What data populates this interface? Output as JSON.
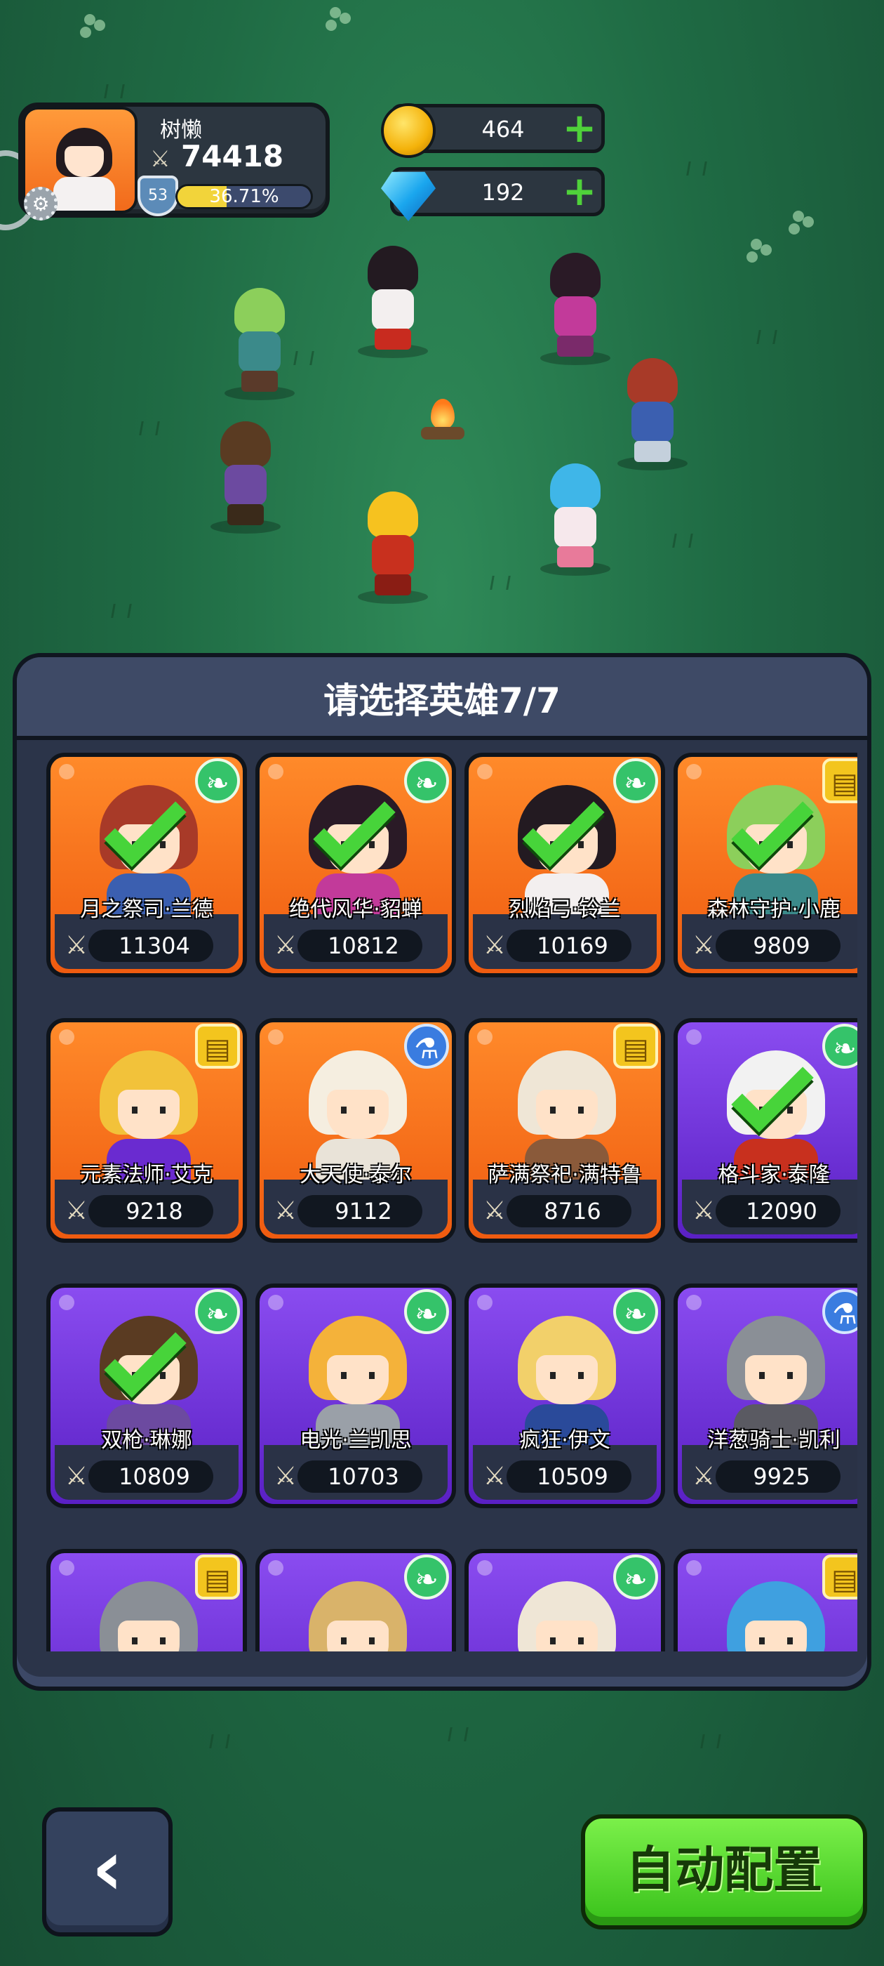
{
  "player": {
    "name": "树懒",
    "power": "74418",
    "level": "53",
    "xp_percent_text": "36.71%",
    "xp_fraction": 0.3671
  },
  "currency": {
    "gold": "464",
    "gems": "192"
  },
  "panel": {
    "title": "请选择英雄7/7"
  },
  "heroes": [
    {
      "name": "月之祭司·兰德",
      "power": "11304",
      "rarity": "orange",
      "badge": "green",
      "selected": true
    },
    {
      "name": "绝代风华·貂蝉",
      "power": "10812",
      "rarity": "orange",
      "badge": "green",
      "selected": true
    },
    {
      "name": "烈焰弓·铃兰",
      "power": "10169",
      "rarity": "orange",
      "badge": "green",
      "selected": true
    },
    {
      "name": "森林守护·小鹿",
      "power": "9809",
      "rarity": "orange",
      "badge": "book",
      "selected": true
    },
    {
      "name": "元素法师·艾克",
      "power": "9218",
      "rarity": "orange",
      "badge": "book",
      "selected": false
    },
    {
      "name": "大天使·泰尔",
      "power": "9112",
      "rarity": "orange",
      "badge": "potion",
      "selected": false
    },
    {
      "name": "萨满祭祀·满特鲁",
      "power": "8716",
      "rarity": "orange",
      "badge": "book",
      "selected": false
    },
    {
      "name": "格斗家·泰隆",
      "power": "12090",
      "rarity": "purple",
      "badge": "green",
      "selected": true
    },
    {
      "name": "双枪·琳娜",
      "power": "10809",
      "rarity": "purple",
      "badge": "green",
      "selected": true
    },
    {
      "name": "电光·兰凯思",
      "power": "10703",
      "rarity": "purple",
      "badge": "green",
      "selected": false
    },
    {
      "name": "疯狂·伊文",
      "power": "10509",
      "rarity": "purple",
      "badge": "green",
      "selected": false
    },
    {
      "name": "洋葱骑士·凯利",
      "power": "9925",
      "rarity": "purple",
      "badge": "potion",
      "selected": false
    },
    {
      "name": "",
      "power": "",
      "rarity": "purple",
      "badge": "book",
      "selected": false
    },
    {
      "name": "",
      "power": "",
      "rarity": "purple",
      "badge": "green",
      "selected": false
    },
    {
      "name": "",
      "power": "",
      "rarity": "purple",
      "badge": "green",
      "selected": false
    },
    {
      "name": "",
      "power": "",
      "rarity": "purple",
      "badge": "book",
      "selected": false
    }
  ],
  "buttons": {
    "back_icon": "chevron-left-icon",
    "auto_label": "自动配置"
  },
  "colors": {
    "accent_green": "#47d43a",
    "orange_card": "#ef5b10",
    "purple_card": "#5a20c4",
    "panel_bg": "#2b3449"
  }
}
